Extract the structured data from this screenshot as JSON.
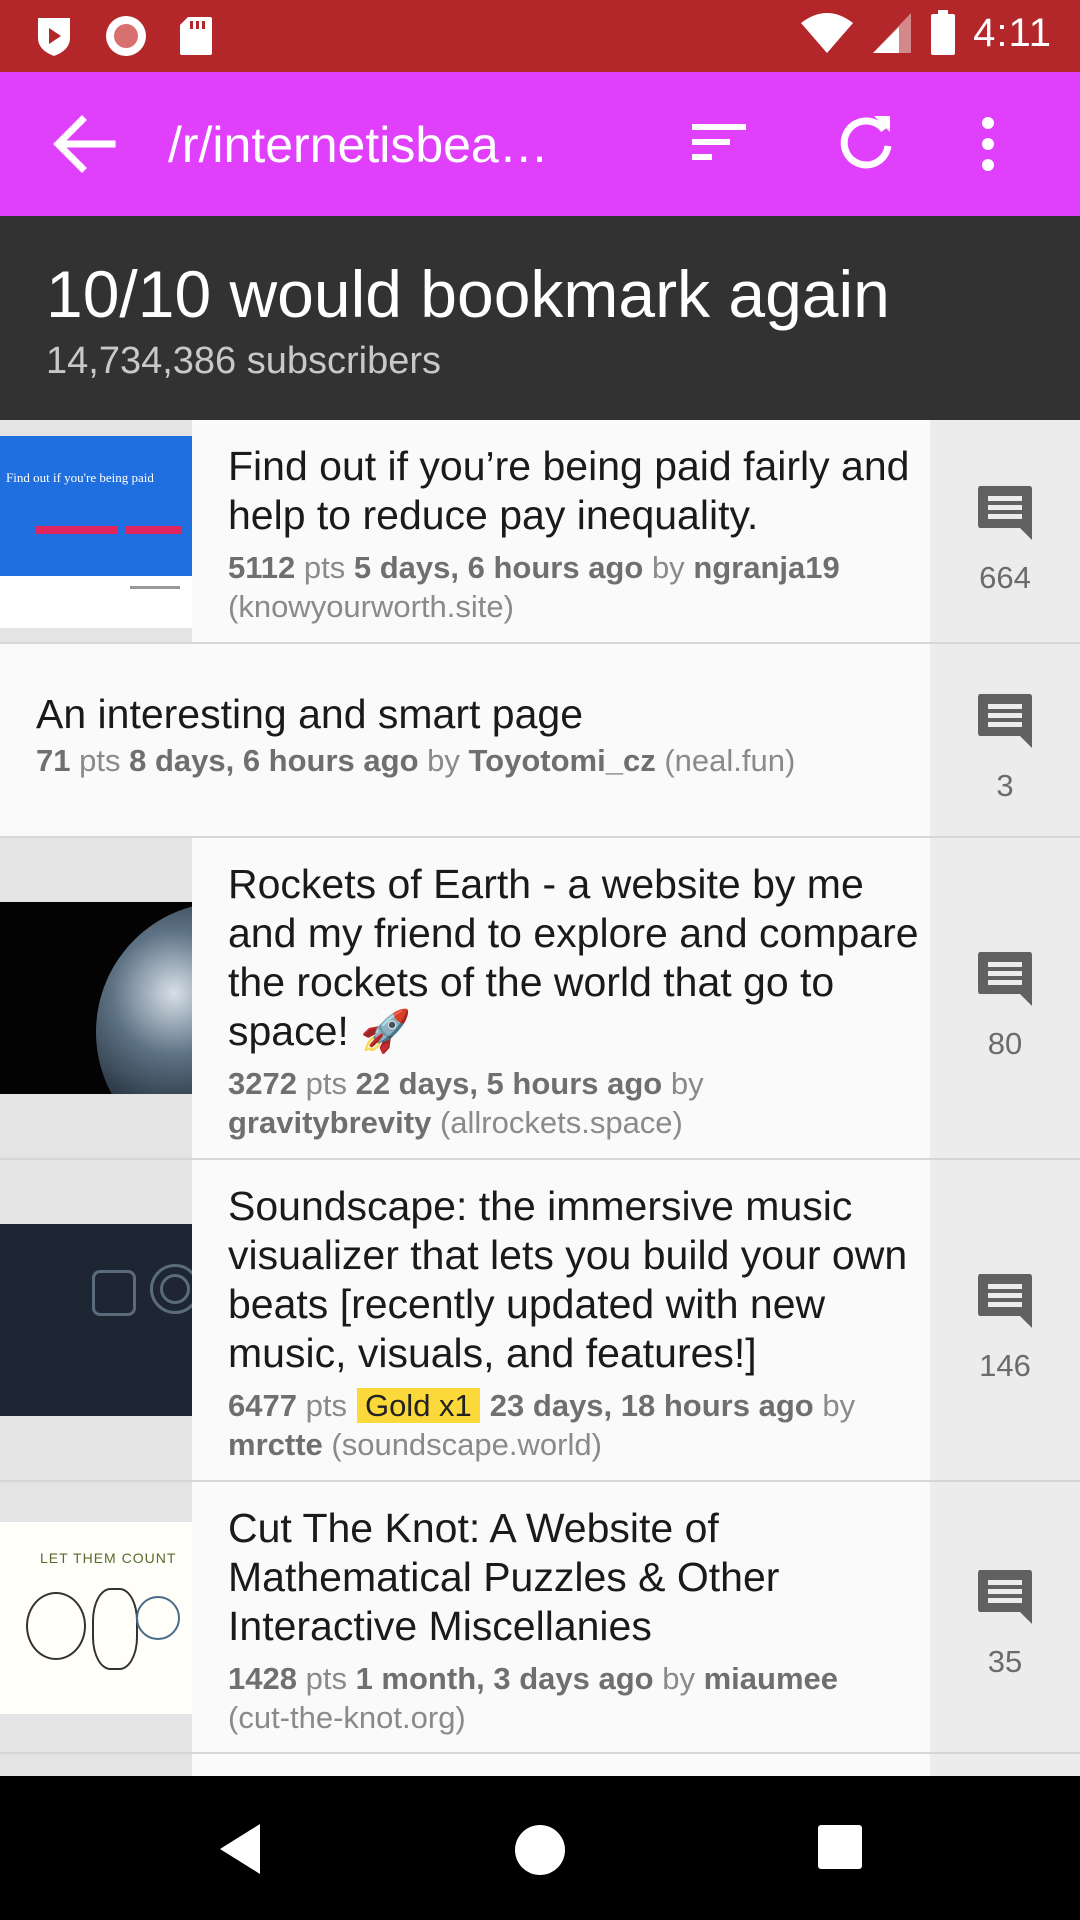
{
  "status_bar": {
    "time": "4:11",
    "icons": [
      "app-shield-icon",
      "record-icon",
      "sd-card-icon",
      "wifi-icon",
      "signal-icon",
      "battery-icon"
    ]
  },
  "toolbar": {
    "title": "/r/internetisbea…",
    "background": "#e040fb",
    "icons": [
      "back-arrow-icon",
      "sort-icon",
      "refresh-icon",
      "more-vert-icon"
    ]
  },
  "subreddit": {
    "tagline": "10/10 would bookmark again",
    "subscribers": "14,734,386 subscribers"
  },
  "posts": [
    {
      "title": "Find out if you’re being paid fairly and help to reduce pay inequality.",
      "score": "5112",
      "pts_label": "pts",
      "age": "5 days, 6 hours ago",
      "by_label": "by",
      "author": "ngranja19",
      "domain": "(knowyourworth.site)",
      "comments": "664",
      "thumb_text": "Find out if you're being paid"
    },
    {
      "title": "An interesting and smart page",
      "score": "71",
      "pts_label": "pts",
      "age": "8 days, 6 hours ago",
      "by_label": "by",
      "author": "Toyotomi_cz",
      "domain": "(neal.fun)",
      "comments": "3"
    },
    {
      "title": "Rockets of Earth - a website by me and my friend to explore and compare the rockets of the world that go to space! 🚀",
      "score": "3272",
      "pts_label": "pts",
      "age": "22 days, 5 hours ago",
      "by_label": "by",
      "author": "gravitybrevity",
      "domain": "(allrockets.space)",
      "comments": "80"
    },
    {
      "title": "Soundscape: the immersive music visualizer that lets you build your own beats [recently updated with new music, visuals, and features!]",
      "score": "6477",
      "pts_label": "pts",
      "gold": "Gold x1",
      "age": "23 days, 18 hours ago",
      "by_label": "by",
      "author": "mrctte",
      "domain": "(soundscape.world)",
      "comments": "146"
    },
    {
      "title": "Cut The Knot: A Website of Mathematical Puzzles & Other Interactive Miscellanies",
      "score": "1428",
      "pts_label": "pts",
      "age": "1 month, 3 days ago",
      "by_label": "by",
      "author": "miaumee",
      "domain": "(cut-the-knot.org)",
      "comments": "35",
      "thumb_text": "LET THEM COUNT"
    }
  ],
  "nav_bar": {
    "icons": [
      "back-triangle-icon",
      "home-circle-icon",
      "recents-square-icon"
    ]
  }
}
